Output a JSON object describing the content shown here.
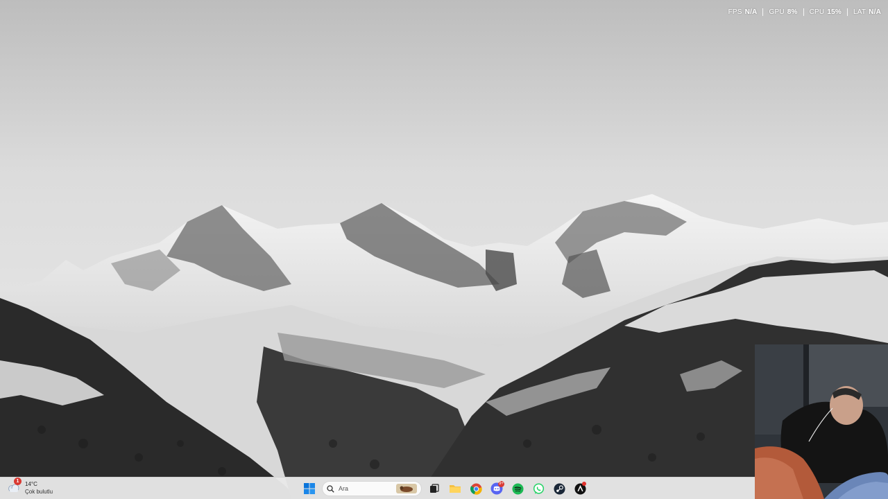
{
  "overlay": {
    "metrics": [
      {
        "label": "FPS",
        "value": "N/A"
      },
      {
        "label": "GPU",
        "value": "8%"
      },
      {
        "label": "CPU",
        "value": "15%"
      },
      {
        "label": "LAT",
        "value": "N/A"
      }
    ]
  },
  "taskbar": {
    "weather": {
      "temp": "14°C",
      "desc": "Çok bulutlu",
      "badge": "1",
      "icon": "cloud-icon"
    },
    "search": {
      "placeholder": "Ara",
      "icon": "search-icon"
    },
    "apps": [
      {
        "name": "start",
        "icon": "windows-start-icon"
      },
      {
        "name": "task-view",
        "icon": "task-view-icon"
      },
      {
        "name": "file-explorer",
        "icon": "folder-icon"
      },
      {
        "name": "chrome",
        "icon": "chrome-icon"
      },
      {
        "name": "discord",
        "icon": "discord-icon",
        "badge": "9+"
      },
      {
        "name": "spotify",
        "icon": "spotify-icon"
      },
      {
        "name": "whatsapp",
        "icon": "whatsapp-icon"
      },
      {
        "name": "steam",
        "icon": "steam-icon"
      },
      {
        "name": "other",
        "icon": "app-icon"
      }
    ]
  },
  "colors": {
    "accent_blue": "#0067c0",
    "badge_red": "#d93a33",
    "discord": "#5865f2",
    "spotify": "#1db954",
    "whatsapp": "#25d366",
    "steam": "#1b2838"
  }
}
